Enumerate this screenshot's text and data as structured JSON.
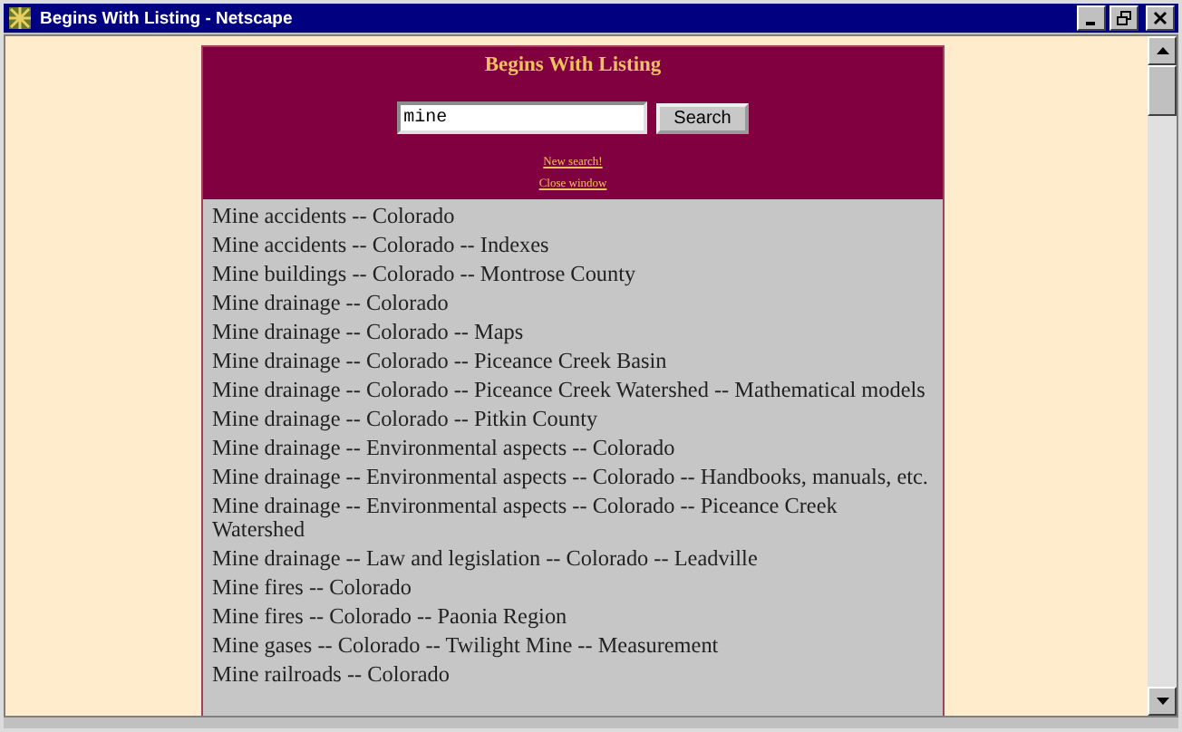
{
  "window": {
    "title": "Begins With Listing - Netscape"
  },
  "header": {
    "title": "Begins With Listing",
    "search": {
      "value": "mine",
      "button": "Search"
    },
    "links": [
      "New search!",
      "Close window"
    ]
  },
  "results": [
    "Mine accidents -- Colorado",
    "Mine accidents -- Colorado -- Indexes",
    "Mine buildings -- Colorado -- Montrose County",
    "Mine drainage -- Colorado",
    "Mine drainage -- Colorado -- Maps",
    "Mine drainage -- Colorado -- Piceance Creek Basin",
    "Mine drainage -- Colorado -- Piceance Creek Watershed -- Mathematical models",
    "Mine drainage -- Colorado -- Pitkin County",
    "Mine drainage -- Environmental aspects -- Colorado",
    "Mine drainage -- Environmental aspects -- Colorado -- Handbooks, manuals, etc.",
    "Mine drainage -- Environmental aspects -- Colorado -- Piceance Creek Watershed",
    "Mine drainage -- Law and legislation -- Colorado -- Leadville",
    "Mine fires -- Colorado",
    "Mine fires -- Colorado -- Paonia Region",
    "Mine gases -- Colorado -- Twilight Mine -- Measurement",
    "Mine railroads -- Colorado"
  ]
}
